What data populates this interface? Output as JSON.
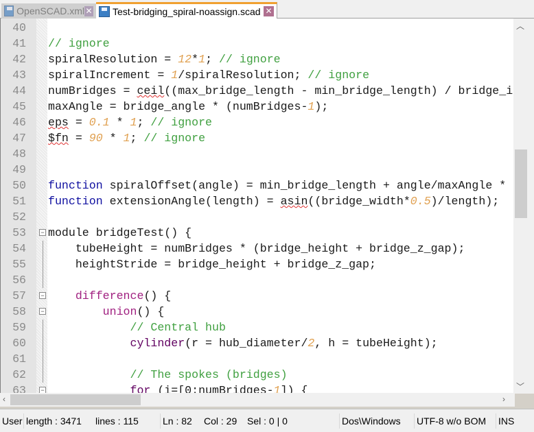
{
  "tabs": [
    {
      "label": "OpenSCAD.xml",
      "active": false
    },
    {
      "label": "Test-bridging_spiral-noassign.scad",
      "active": true
    }
  ],
  "lines": [
    {
      "n": "40",
      "t": []
    },
    {
      "n": "41",
      "t": [
        [
          "// ignore",
          "c"
        ]
      ]
    },
    {
      "n": "42",
      "t": [
        [
          "spiralResolution = ",
          ""
        ],
        [
          "12",
          "n"
        ],
        [
          "*",
          ""
        ],
        [
          "1",
          "n"
        ],
        [
          "; ",
          ""
        ],
        [
          "// ignore",
          "c"
        ]
      ]
    },
    {
      "n": "43",
      "t": [
        [
          "spiralIncrement = ",
          ""
        ],
        [
          "1",
          "n"
        ],
        [
          "/spiralResolution; ",
          ""
        ],
        [
          "// ignore",
          "c"
        ]
      ]
    },
    {
      "n": "44",
      "t": [
        [
          "numBridges = ",
          ""
        ],
        [
          "ceil",
          "sq"
        ],
        [
          "((max_bridge_length - min_bridge_length) / bridge_i",
          ""
        ]
      ]
    },
    {
      "n": "45",
      "t": [
        [
          "maxAngle = bridge_angle * (numBridges-",
          ""
        ],
        [
          "1",
          "n"
        ],
        [
          ");",
          ""
        ]
      ]
    },
    {
      "n": "46",
      "t": [
        [
          "eps",
          "sq"
        ],
        [
          " = ",
          ""
        ],
        [
          "0.1",
          "n"
        ],
        [
          " * ",
          ""
        ],
        [
          "1",
          "n"
        ],
        [
          "; ",
          ""
        ],
        [
          "// ignore",
          "c"
        ]
      ]
    },
    {
      "n": "47",
      "t": [
        [
          "$fn",
          "sq"
        ],
        [
          " = ",
          ""
        ],
        [
          "90",
          "n"
        ],
        [
          " * ",
          ""
        ],
        [
          "1",
          "n"
        ],
        [
          "; ",
          ""
        ],
        [
          "// ignore",
          "c"
        ]
      ]
    },
    {
      "n": "48",
      "t": []
    },
    {
      "n": "49",
      "t": []
    },
    {
      "n": "50",
      "t": [
        [
          "function",
          "k"
        ],
        [
          " spiralOffset(angle) = min_bridge_length + angle/maxAngle *",
          ""
        ]
      ]
    },
    {
      "n": "51",
      "t": [
        [
          "function",
          "k"
        ],
        [
          " extensionAngle(length) = ",
          ""
        ],
        [
          "asin",
          "sq"
        ],
        [
          "((bridge_width*",
          ""
        ],
        [
          "0.5",
          "n"
        ],
        [
          ")/length);",
          ""
        ]
      ]
    },
    {
      "n": "52",
      "t": []
    },
    {
      "n": "53",
      "t": [
        [
          "module bridgeTest() {",
          ""
        ]
      ],
      "fold": "minus"
    },
    {
      "n": "54",
      "t": [
        [
          "    tubeHeight = numBridges * (bridge_height + bridge_z_gap);",
          ""
        ]
      ]
    },
    {
      "n": "55",
      "t": [
        [
          "    heightStride = bridge_height + bridge_z_gap;",
          ""
        ]
      ]
    },
    {
      "n": "56",
      "t": []
    },
    {
      "n": "57",
      "t": [
        [
          "    ",
          ""
        ],
        [
          "difference",
          "b"
        ],
        [
          "() {",
          ""
        ]
      ],
      "fold": "minus"
    },
    {
      "n": "58",
      "t": [
        [
          "        ",
          ""
        ],
        [
          "union",
          "b"
        ],
        [
          "() {",
          ""
        ]
      ],
      "fold": "minus"
    },
    {
      "n": "59",
      "t": [
        [
          "            ",
          ""
        ],
        [
          "// Central hub",
          "c"
        ]
      ]
    },
    {
      "n": "60",
      "t": [
        [
          "            ",
          ""
        ],
        [
          "cylinder",
          "p"
        ],
        [
          "(r = hub_diameter/",
          ""
        ],
        [
          "2",
          "n"
        ],
        [
          ", h = tubeHeight);",
          ""
        ]
      ]
    },
    {
      "n": "61",
      "t": []
    },
    {
      "n": "62",
      "t": [
        [
          "            ",
          ""
        ],
        [
          "// The spokes (bridges)",
          "c"
        ]
      ]
    },
    {
      "n": "63",
      "t": [
        [
          "            ",
          ""
        ],
        [
          "for",
          "p"
        ],
        [
          " (i=[0:numBridges-",
          ""
        ],
        [
          "1",
          "n"
        ],
        [
          "]) {",
          ""
        ]
      ],
      "fold": "minus"
    }
  ],
  "status": {
    "lexer": "User",
    "length": "length : 3471",
    "lines": "lines : 115",
    "ln": "Ln : 82",
    "col": "Col : 29",
    "sel": "Sel : 0 | 0",
    "eol": "Dos\\Windows",
    "encoding": "UTF-8 w/o BOM",
    "mode": "INS"
  },
  "colors": {
    "keyword": "#1010a0",
    "number": "#e0a050",
    "comment": "#40a040",
    "builtin": "#a02080",
    "active_tab_accent": "#f0a030"
  }
}
